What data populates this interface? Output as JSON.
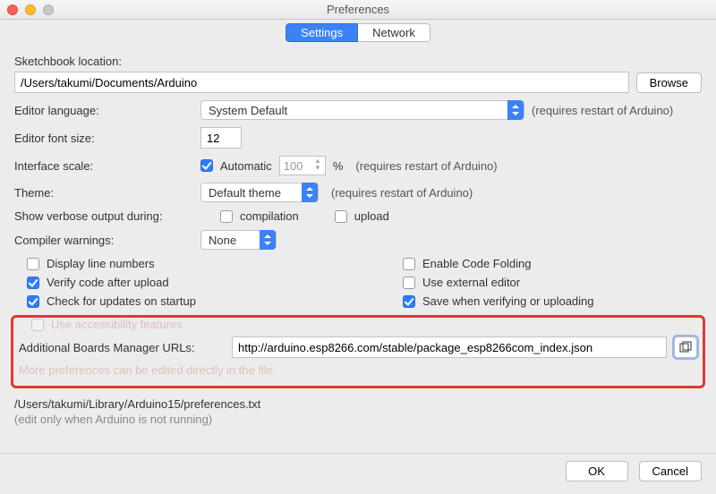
{
  "window": {
    "title": "Preferences"
  },
  "tabs": {
    "settings": "Settings",
    "network": "Network"
  },
  "sketchbook": {
    "label": "Sketchbook location:",
    "path": "/Users/takumi/Documents/Arduino",
    "browse": "Browse"
  },
  "language": {
    "label": "Editor language:",
    "value": "System Default",
    "hint": "(requires restart of Arduino)"
  },
  "fontsize": {
    "label": "Editor font size:",
    "value": "12"
  },
  "scale": {
    "label": "Interface scale:",
    "automatic": "Automatic",
    "value": "100",
    "pct": "%",
    "hint": "(requires restart of Arduino)"
  },
  "theme": {
    "label": "Theme:",
    "value": "Default theme",
    "hint": "(requires restart of Arduino)"
  },
  "verbose": {
    "label": "Show verbose output during:",
    "compilation": "compilation",
    "upload": "upload"
  },
  "warnings": {
    "label": "Compiler warnings:",
    "value": "None"
  },
  "options": {
    "display_line_numbers": "Display line numbers",
    "verify_after_upload": "Verify code after upload",
    "check_updates": "Check for updates on startup",
    "accessibility": "Use accessibility features",
    "enable_folding": "Enable Code Folding",
    "external_editor": "Use external editor",
    "save_verify_upload": "Save when verifying or uploading"
  },
  "boards": {
    "label": "Additional Boards Manager URLs:",
    "value": "http://arduino.esp8266.com/stable/package_esp8266com_index.json"
  },
  "more": {
    "line1": "More preferences can be edited directly in the file",
    "path": "/Users/takumi/Library/Arduino15/preferences.txt",
    "hint": "(edit only when Arduino is not running)"
  },
  "buttons": {
    "ok": "OK",
    "cancel": "Cancel"
  }
}
